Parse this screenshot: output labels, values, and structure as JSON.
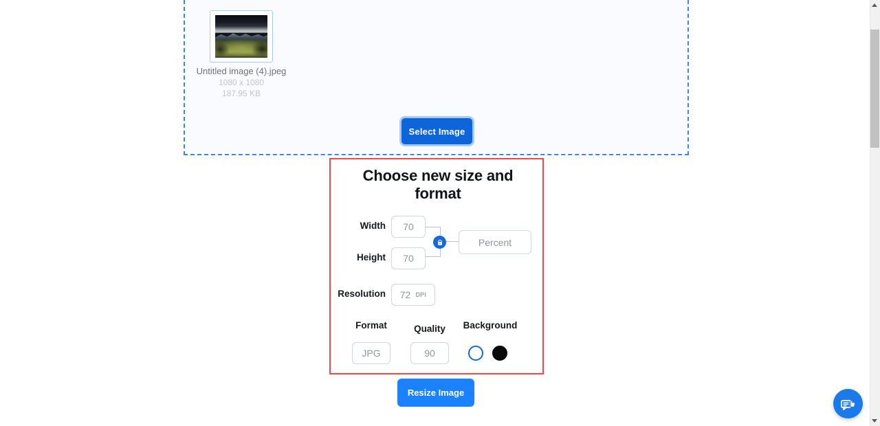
{
  "upload": {
    "file": {
      "name": "Untitled image (4).jpeg",
      "dimensions": "1080 x 1080",
      "size": "187.95 KB",
      "remove_icon": "close-x-icon",
      "thumbnail_alt": "landscape photo of stormy sky over green valley"
    },
    "select_button": "Select Image"
  },
  "panel": {
    "title": "Choose new size and format",
    "width": {
      "label": "Width",
      "value": "70"
    },
    "height": {
      "label": "Height",
      "value": "70"
    },
    "lock_icon": "lock-icon",
    "unit": {
      "value": "Percent"
    },
    "resolution": {
      "label": "Resolution",
      "value": "72",
      "suffix": "DPI"
    },
    "format": {
      "label": "Format",
      "value": "JPG"
    },
    "quality": {
      "label": "Quality",
      "value": "90"
    },
    "background": {
      "label": "Background",
      "options": [
        {
          "name": "transparent-white",
          "color": "#ffffff",
          "selected": true
        },
        {
          "name": "black",
          "color": "#0a0a0a",
          "selected": false
        }
      ]
    },
    "accent_border": "#f4444c"
  },
  "actions": {
    "resize_button": "Resize Image"
  },
  "feedback": {
    "icon": "feedback-thumbs-up-icon"
  },
  "theme": {
    "primary_blue": "#0d65d9",
    "bright_blue": "#1a82fc",
    "dropzone_border": "#3d82f7",
    "dropzone_bg": "#f9fbfe"
  }
}
